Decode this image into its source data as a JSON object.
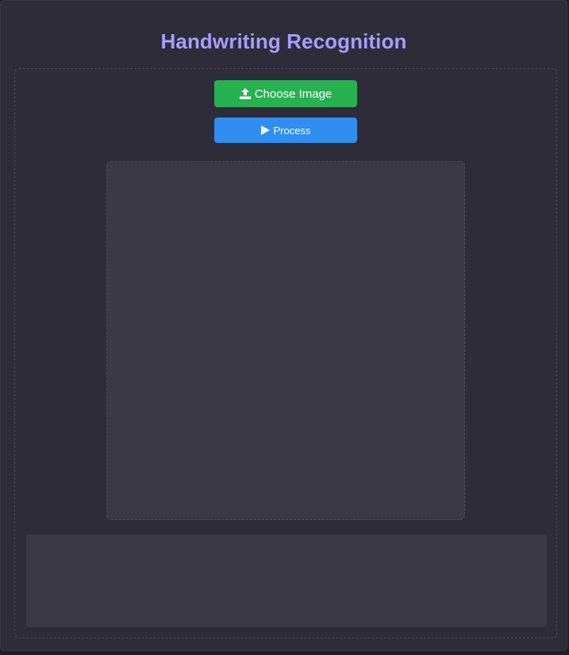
{
  "app": {
    "title": "Handwriting Recognition"
  },
  "controls": {
    "choose_label": "Choose Image",
    "choose_icon": "upload-icon",
    "process_label": "Process",
    "process_icon": "play-icon"
  },
  "preview": {
    "content": ""
  },
  "output": {
    "text": ""
  },
  "colors": {
    "title": "#a99cff",
    "choose_button": "#27b151",
    "process_button": "#2f8ef0",
    "background": "#2e2c39",
    "panel_fill": "#3a3845"
  }
}
